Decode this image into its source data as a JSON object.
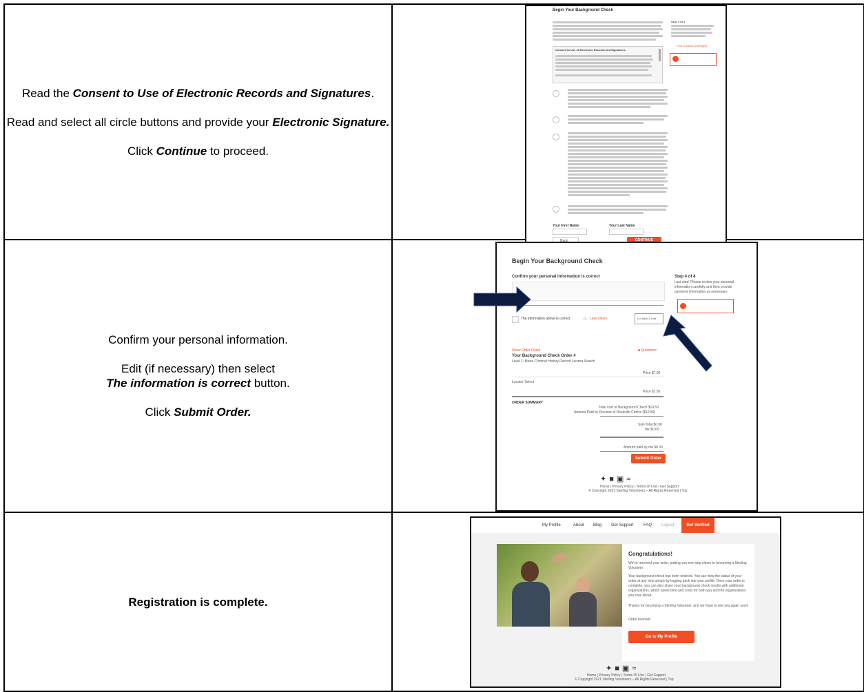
{
  "rows": [
    {
      "lines": [
        {
          "pre": "Read the ",
          "em": "Consent to Use of Electronic Records and Signatures",
          "post": "."
        },
        {
          "pre": "Read and select all circle buttons and provide your ",
          "em": "Electronic Signature.",
          "post": ""
        },
        {
          "pre": "Click ",
          "em": "Continue",
          "post": " to proceed."
        }
      ],
      "shot": {
        "title": "Begin Your Background Check",
        "step": "Step 3 of 4",
        "consent_heading": "Consent to Use of Electronic Records and Signatures",
        "first_name": "Your First Name",
        "last_name": "Your Last Name",
        "back": "Back",
        "continue": "CONTINUE",
        "print": "Print Consent and Rights"
      }
    },
    {
      "lines": [
        {
          "pre": "Confirm your personal information.",
          "em": "",
          "post": ""
        },
        {
          "pre": "Edit (if necessary) then select ",
          "em": "The information is correct",
          "post": " button."
        },
        {
          "pre": "Click ",
          "em": "Submit Order.",
          "post": ""
        }
      ],
      "shot": {
        "title": "Begin Your Background Check",
        "confirm": "Confirm your personal information is correct",
        "step": "Step 4 of 4",
        "step_text": "Last step! Please review your personal information carefully and then provide payment information as necessary.",
        "info_correct": "The information above is correct.",
        "learn_more": "Learn More",
        "go_back": "Go Back & Edit",
        "show_order": "Show Order Detail",
        "questions": "Questions",
        "order_num": "Your Background Check Order #",
        "level": "Level 1: Basic Criminal History Record Locator Search",
        "price1": "Price $7.00",
        "locator": "Locator Select",
        "price2": "Price $3.50",
        "summary": "ORDER SUMMARY",
        "total": "Total cost of Background Check $10.50",
        "paid_by": "Amount Paid by Diocese of Rockville Centre ($10.50)",
        "subtotal": "Sub-Total $0.00",
        "tax": "Tax $0.00",
        "paid_me": "Amount paid by me $0.00",
        "submit": "Submit Order",
        "footer_links": "Home | Privacy Policy | Terms Of Use | Get Support",
        "copyright": "© Copyright 2021 Sterling Volunteers – All Rights Reserved | Top"
      }
    },
    {
      "lines": [
        {
          "pre": "",
          "em": "",
          "post": "",
          "bold": "Registration is complete."
        }
      ],
      "shot": {
        "nav": [
          "My Profile",
          "About",
          "Blog",
          "Get Support",
          "FAQ",
          "Logout"
        ],
        "get_verified": "Get Verified",
        "congrats": "Congratulations!",
        "p1": "We've received your order, putting you one step closer to becoming a Sterling Volunteer.",
        "p2": "Your background check has been ordered. You can view the status of your order at any time simply by logging back into your profile. Once your order is complete, you can also share your background check results with additional organizations, which saves time and costs for both you and the organizations you care about.",
        "p3": "Thanks for becoming a Sterling Volunteer, and we hope to see you again soon!",
        "order_number": "Order Number:",
        "go_profile": "Go to My Profile",
        "footer_links": "Home | Privacy Policy | Terms Of Use | Get Support",
        "copyright": "© Copyright 2021 Sterling Volunteers – All Rights Reserved | Top"
      }
    }
  ],
  "colors": {
    "accent": "#f04e23",
    "arrow": "#0d1b3e"
  }
}
